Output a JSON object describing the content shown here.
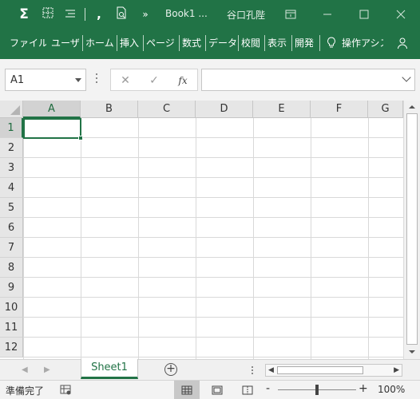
{
  "title_bar": {
    "document_title": "Book1 ...",
    "user_name": "谷口孔陛"
  },
  "ribbon": {
    "tabs": [
      "ファイル",
      "ユーザー",
      "ホーム",
      "挿入",
      "ページ",
      "数式",
      "データ",
      "校閲",
      "表示",
      "開発",
      "操作アシス"
    ]
  },
  "formula_bar": {
    "name_box_value": "A1",
    "cancel_symbol": "✕",
    "enter_symbol": "✓",
    "function_symbol": "fx",
    "formula_value": ""
  },
  "grid": {
    "columns": [
      "A",
      "B",
      "C",
      "D",
      "E",
      "F",
      "G"
    ],
    "rows": [
      "1",
      "2",
      "3",
      "4",
      "5",
      "6",
      "7",
      "8",
      "9",
      "10",
      "11",
      "12"
    ],
    "active_cell": "A1"
  },
  "sheets": {
    "tabs": [
      "Sheet1"
    ],
    "active": "Sheet1",
    "add_symbol": "+"
  },
  "status_bar": {
    "status": "準備完了",
    "zoom_minus": "-",
    "zoom_plus": "+",
    "zoom_level": "100%",
    "zoom_fraction": 0.5
  },
  "colors": {
    "accent": "#217346",
    "header_bg": "#e6e6e6",
    "grid_line": "#d9d9d9"
  }
}
